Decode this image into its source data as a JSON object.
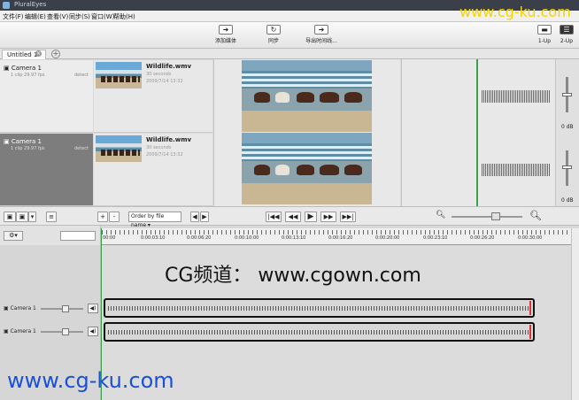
{
  "window": {
    "title": "PluralEyes"
  },
  "menu": [
    "文件(F)",
    "编辑(E)",
    "查看(V)",
    "同步(S)",
    "窗口(W)",
    "帮助(H)"
  ],
  "toolbar": {
    "add_media": "添加媒体",
    "sync": "同步",
    "export": "导出时间线...",
    "layout_1up": "1-Up",
    "layout_2up": "2-Up"
  },
  "tabs": [
    {
      "label": "Untitled 1"
    }
  ],
  "cameras": [
    {
      "name": "Camera 1",
      "meta": "1 clip    29.97 fps",
      "status": "detect",
      "clip": {
        "file": "Wildlife.wmv",
        "duration": "30 seconds",
        "date": "2009/7/14 13:32"
      }
    },
    {
      "name": "Camera 1",
      "meta": "1 clip    29.97 fps",
      "status": "detect",
      "clip": {
        "file": "Wildlife.wmv",
        "duration": "30 seconds",
        "date": "2009/7/14 13:32"
      }
    }
  ],
  "mixer": {
    "db_top": "0 dB",
    "db_bottom": "0 dB"
  },
  "controls": {
    "add": "+",
    "remove": "-",
    "order_select": "Order by file name",
    "zoom_out_icon": "zoom-out",
    "zoom_in_icon": "zoom-in"
  },
  "ruler": {
    "labels": [
      "00:00",
      "0:00:03:10",
      "0:00:06:20",
      "0:00:10:00",
      "0:00:13:10",
      "0:00:16:20",
      "0:00:20:00",
      "0:00:23:10",
      "0:00:26:20",
      "0:00:30:00"
    ]
  },
  "timeline_tracks": [
    {
      "name": "Camera 1"
    },
    {
      "name": "Camera 1"
    }
  ],
  "watermarks": {
    "top_right": "www.cg-ku.com",
    "center": "CG频道：  www.cgown.com",
    "bottom_left": "www.cg-ku.com"
  },
  "colors": {
    "playhead": "#3aa04a",
    "watermark_blue": "#1a4fd8",
    "watermark_yellow": "#f5d400"
  }
}
